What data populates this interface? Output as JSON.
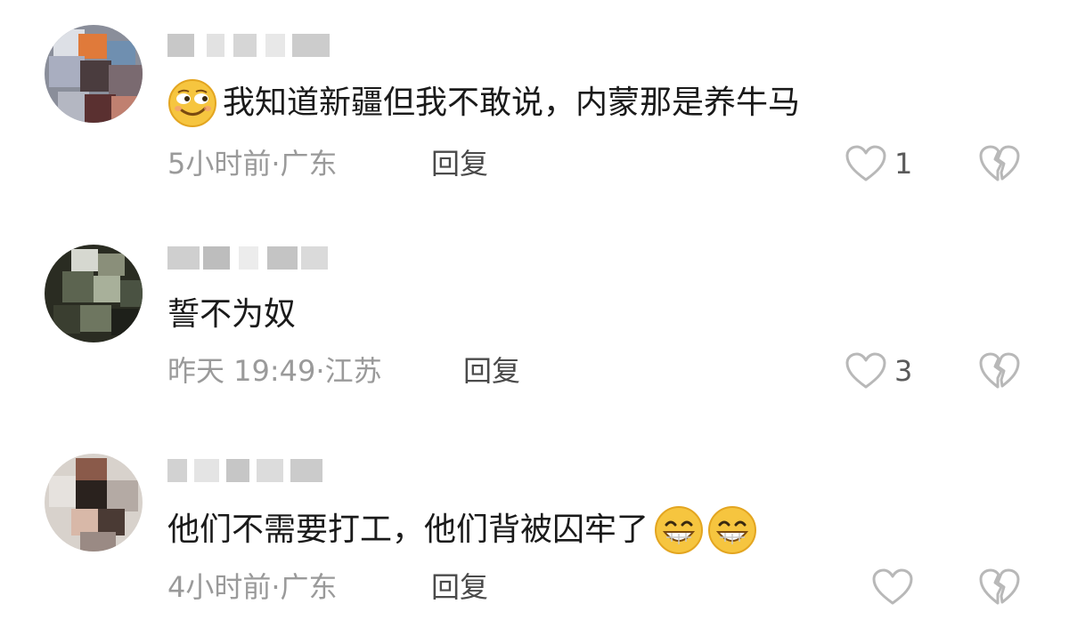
{
  "comments": [
    {
      "content": "我知道新疆但我不敢说，内蒙那是养牛马",
      "time": "5小时前",
      "location": "广东",
      "reply_label": "回复",
      "like_count": "1"
    },
    {
      "content": "誓不为奴",
      "time": "昨天 19:49",
      "location": "江苏",
      "reply_label": "回复",
      "like_count": "3"
    },
    {
      "content": "他们不需要打工，他们背被囚牢了",
      "time": "4小时前",
      "location": "广东",
      "reply_label": "回复",
      "like_count": ""
    }
  ],
  "icons": {
    "like": "heart-outline-icon",
    "dislike": "broken-heart-icon",
    "smirk_emoji": "smirk-emoji",
    "grin_emoji": "grin-emoji"
  },
  "colors": {
    "text_primary": "#1a1a1a",
    "text_secondary": "#9a9a9a",
    "reply_text": "#4a4a4a",
    "icon_gray": "#b8b8b8",
    "emoji_yellow": "#f6c53f"
  }
}
